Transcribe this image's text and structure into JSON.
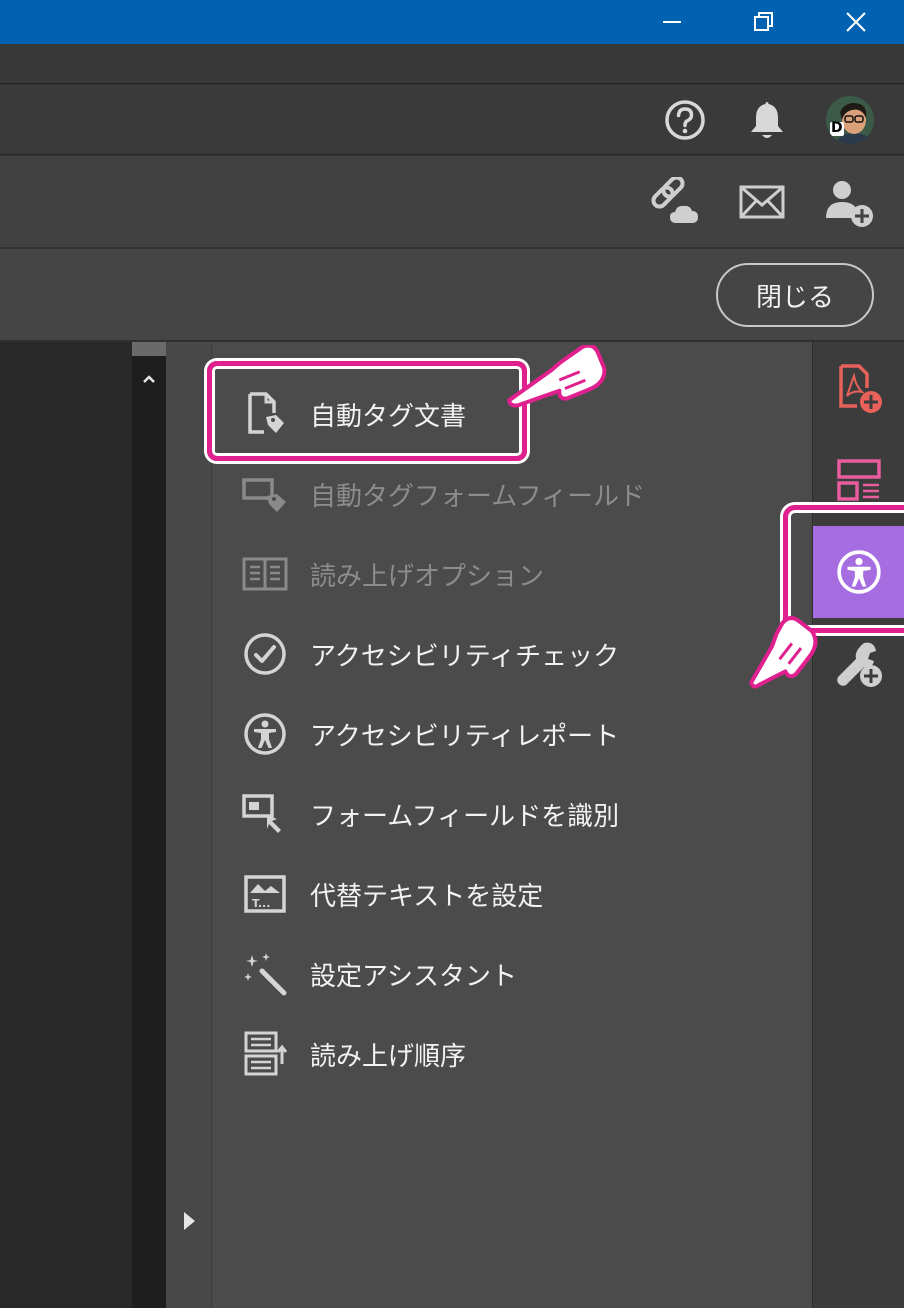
{
  "window": {
    "controls": [
      "minimize",
      "restore",
      "close"
    ]
  },
  "header": {
    "help_icon": "question-circle-icon",
    "notifications_icon": "bell-icon",
    "avatar_initial": "D"
  },
  "toolbar": {
    "share_link_icon": "cloud-link-icon",
    "email_icon": "envelope-icon",
    "add_user_icon": "user-plus-icon"
  },
  "subbar": {
    "close_label": "閉じる"
  },
  "tools": {
    "items": [
      {
        "label": "自動タグ文書",
        "icon": "tag-document-icon",
        "enabled": true
      },
      {
        "label": "自動タグフォームフィールド",
        "icon": "tag-form-field-icon",
        "enabled": false
      },
      {
        "label": "読み上げオプション",
        "icon": "book-icon",
        "enabled": false
      },
      {
        "label": "アクセシビリティチェック",
        "icon": "check-circle-icon",
        "enabled": true
      },
      {
        "label": "アクセシビリティレポート",
        "icon": "accessibility-icon",
        "enabled": true
      },
      {
        "label": "フォームフィールドを識別",
        "icon": "form-identify-icon",
        "enabled": true
      },
      {
        "label": "代替テキストを設定",
        "icon": "alt-text-icon",
        "enabled": true
      },
      {
        "label": "設定アシスタント",
        "icon": "magic-wand-icon",
        "enabled": true
      },
      {
        "label": "読み上げ順序",
        "icon": "reading-order-icon",
        "enabled": true
      }
    ]
  },
  "rail": {
    "items": [
      {
        "icon": "create-pdf-icon"
      },
      {
        "icon": "organize-pages-icon"
      },
      {
        "icon": "accessibility-icon",
        "active": true
      },
      {
        "icon": "add-tools-icon"
      }
    ]
  },
  "colors": {
    "titlebar": "#0062b1",
    "accent_active": "#a66de0",
    "annotation": "#e0208e",
    "pdf_red": "#e8615a",
    "organize_pink": "#e85d9e"
  }
}
